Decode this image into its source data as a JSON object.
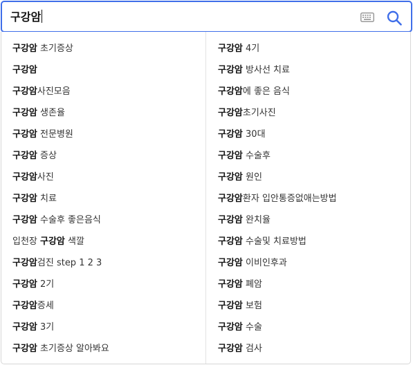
{
  "search": {
    "query": "구강암"
  },
  "icons": {
    "keyboard": "keyboard-icon",
    "search": "search-icon"
  },
  "colors": {
    "accent": "#3f6ee9",
    "icon_gray": "#9a9a9a"
  },
  "suggestions": {
    "left": [
      {
        "pre": "",
        "bold": "구강암",
        "post": " 초기증상"
      },
      {
        "pre": "",
        "bold": "구강암",
        "post": ""
      },
      {
        "pre": "",
        "bold": "구강암",
        "post": "사진모음"
      },
      {
        "pre": "",
        "bold": "구강암",
        "post": " 생존율"
      },
      {
        "pre": "",
        "bold": "구강암",
        "post": " 전문병원"
      },
      {
        "pre": "",
        "bold": "구강암",
        "post": " 증상"
      },
      {
        "pre": "",
        "bold": "구강암",
        "post": "사진"
      },
      {
        "pre": "",
        "bold": "구강암",
        "post": " 치료"
      },
      {
        "pre": "",
        "bold": "구강암",
        "post": " 수술후 좋은음식"
      },
      {
        "pre": "입천장 ",
        "bold": "구강암",
        "post": " 색깔"
      },
      {
        "pre": "",
        "bold": "구강암",
        "post": "검진 step 1 2 3"
      },
      {
        "pre": "",
        "bold": "구강암",
        "post": " 2기"
      },
      {
        "pre": "",
        "bold": "구강암",
        "post": "증세"
      },
      {
        "pre": "",
        "bold": "구강암",
        "post": " 3기"
      },
      {
        "pre": "",
        "bold": "구강암",
        "post": " 초기증상 알아봐요"
      }
    ],
    "right": [
      {
        "pre": "",
        "bold": "구강암",
        "post": " 4기"
      },
      {
        "pre": "",
        "bold": "구강암",
        "post": " 방사선 치료"
      },
      {
        "pre": "",
        "bold": "구강암",
        "post": "에 좋은 음식"
      },
      {
        "pre": "",
        "bold": "구강암",
        "post": "초기사진"
      },
      {
        "pre": "",
        "bold": "구강암",
        "post": " 30대"
      },
      {
        "pre": "",
        "bold": "구강암",
        "post": " 수술후"
      },
      {
        "pre": "",
        "bold": "구강암",
        "post": " 원인"
      },
      {
        "pre": "",
        "bold": "구강암",
        "post": "환자 입안통증없애는방법"
      },
      {
        "pre": "",
        "bold": "구강암",
        "post": " 완치율"
      },
      {
        "pre": "",
        "bold": "구강암",
        "post": " 수술및 치료방법"
      },
      {
        "pre": "",
        "bold": "구강암",
        "post": " 이비인후과"
      },
      {
        "pre": "",
        "bold": "구강암",
        "post": " 폐암"
      },
      {
        "pre": "",
        "bold": "구강암",
        "post": " 보험"
      },
      {
        "pre": "",
        "bold": "구강암",
        "post": " 수술"
      },
      {
        "pre": "",
        "bold": "구강암",
        "post": " 검사"
      }
    ]
  }
}
